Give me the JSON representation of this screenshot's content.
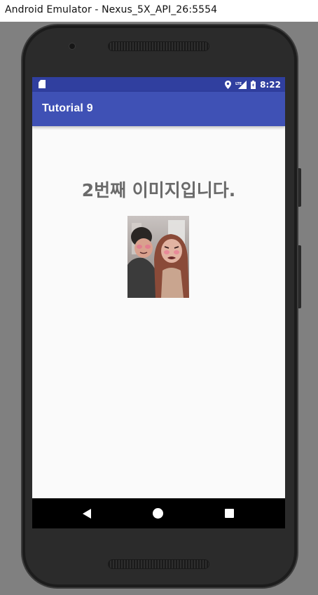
{
  "window": {
    "title": "Android Emulator - Nexus_5X_API_26:5554"
  },
  "status_bar": {
    "time": "8:22",
    "network_label": "LTE",
    "background": "#303f9f"
  },
  "app_bar": {
    "title": "Tutorial 9",
    "background": "#3f51b5"
  },
  "content": {
    "message": "2번째 이미지입니다.",
    "image_description": "photo-of-two-people-with-face-stickers"
  },
  "nav_bar": {
    "icons": [
      "back-icon",
      "home-icon",
      "recents-icon"
    ]
  }
}
